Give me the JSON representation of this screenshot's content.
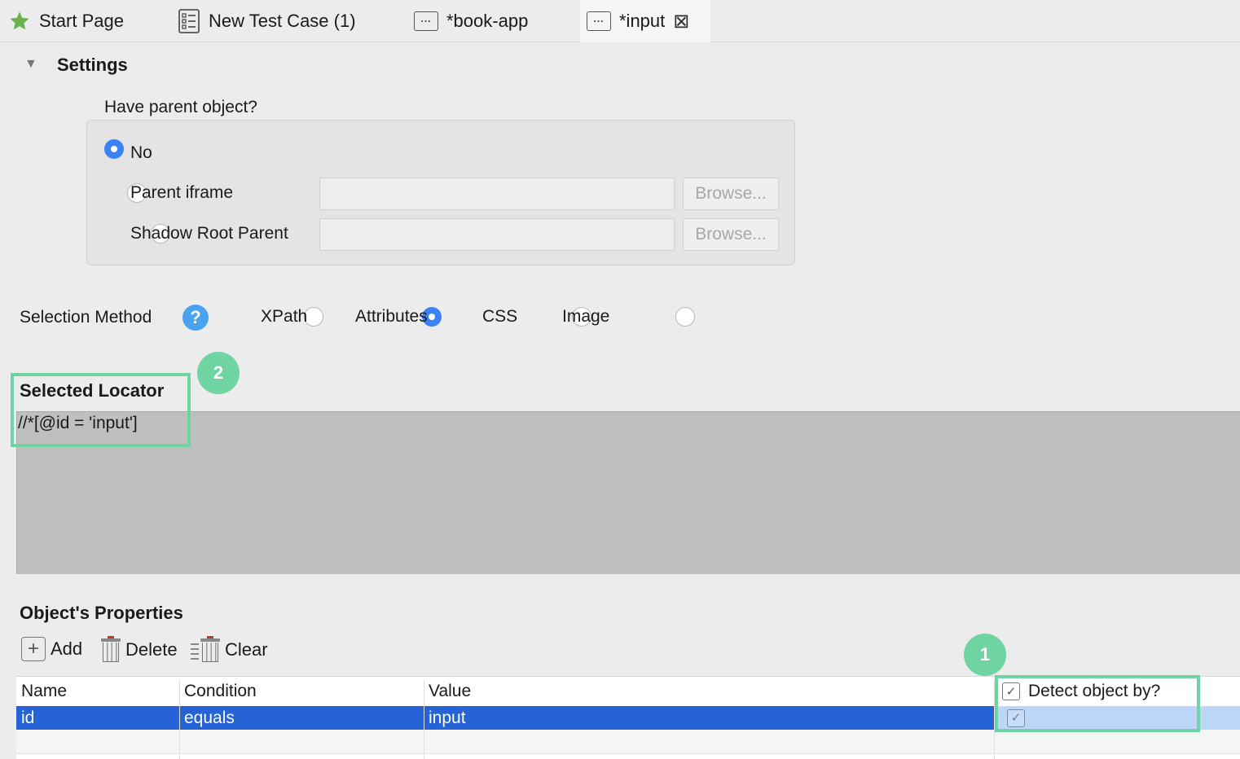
{
  "tabs": [
    {
      "label": "Start Page",
      "icon": "star-icon"
    },
    {
      "label": "New Test Case (1)",
      "icon": "test-case-icon"
    },
    {
      "label": "*book-app",
      "icon": "object-icon"
    },
    {
      "label": "*input",
      "icon": "object-icon",
      "active": true,
      "close_icon": "close-icon"
    }
  ],
  "settings": {
    "title": "Settings",
    "parent_question": "Have parent object?",
    "options": {
      "no": "No",
      "parent_iframe": "Parent iframe",
      "shadow_root": "Shadow Root Parent"
    },
    "selected": "No",
    "browse_label": "Browse...",
    "parent_iframe_value": "",
    "shadow_root_value": ""
  },
  "selection_method": {
    "label": "Selection Method",
    "help": "?",
    "options": [
      "XPath",
      "Attributes",
      "CSS",
      "Image"
    ],
    "selected": "Attributes"
  },
  "locator": {
    "title": "Selected Locator",
    "value": "//*[@id = 'input']"
  },
  "annotations": {
    "badge_1": "1",
    "badge_2": "2",
    "highlight_color": "#6fd3a2"
  },
  "properties": {
    "title": "Object's Properties",
    "toolbar": {
      "add": "Add",
      "delete": "Delete",
      "clear": "Clear"
    },
    "columns": {
      "name": "Name",
      "condition": "Condition",
      "value": "Value",
      "detect": "Detect object by?"
    },
    "rows": [
      {
        "name": "id",
        "condition": "equals",
        "value": "input",
        "detect": true
      }
    ]
  },
  "colors": {
    "selection_blue": "#2563d6",
    "radio_blue": "#3b82f6",
    "help_blue": "#4aa3f0",
    "locator_bg": "#bfbfbf"
  },
  "check_glyph": "✓",
  "add_glyph": "+",
  "close_glyph": "⊠"
}
